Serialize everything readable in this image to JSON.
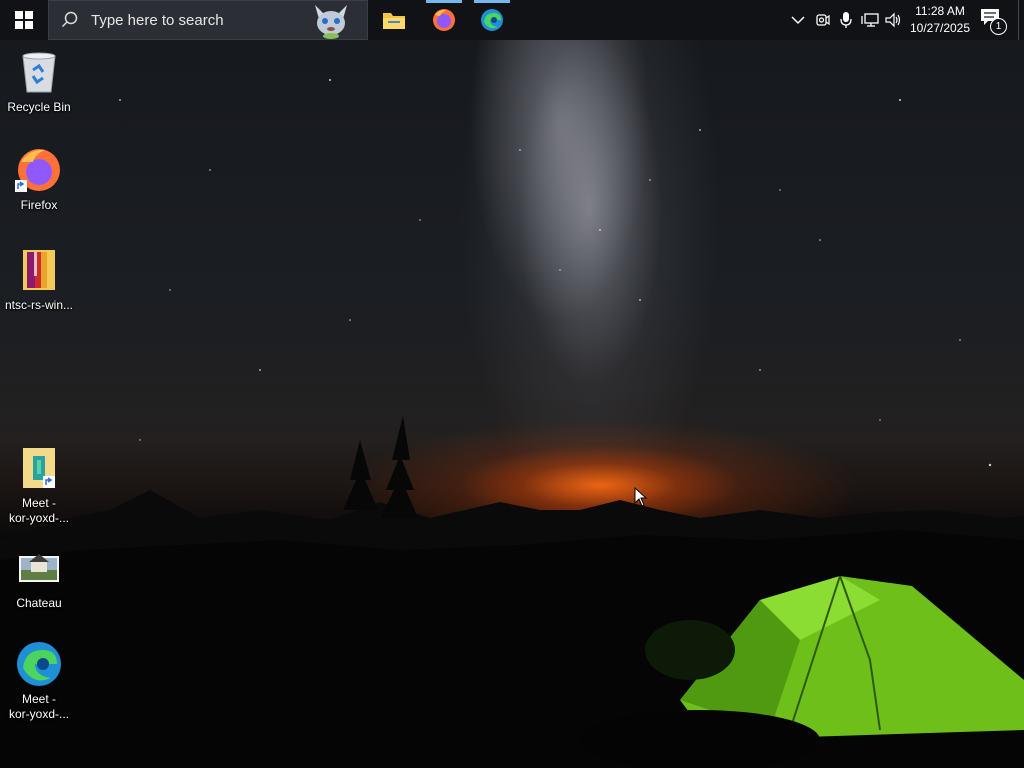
{
  "taskbar": {
    "search_placeholder": "Type here to search",
    "start_icon": "windows-logo-icon",
    "apps": [
      {
        "name": "File Explorer",
        "icon": "folder-icon",
        "running": true
      },
      {
        "name": "Firefox",
        "icon": "firefox-icon",
        "running": true
      },
      {
        "name": "Microsoft Edge",
        "icon": "edge-icon",
        "running": true
      }
    ],
    "tray_icons": [
      "chevron-up-icon",
      "camera-icon",
      "microphone-icon",
      "network-icon",
      "volume-icon"
    ],
    "clock": {
      "time": "11:28 AM",
      "date": "10/27/2025"
    },
    "notification_count": "1",
    "accent_color": "#76b9ed"
  },
  "desktop": {
    "icons": [
      {
        "line1": "Recycle Bin",
        "line2": "",
        "icon": "recycle-bin-icon"
      },
      {
        "line1": "Firefox",
        "line2": "",
        "icon": "firefox-icon"
      },
      {
        "line1": "ntsc-rs-win...",
        "line2": "",
        "icon": "zip-folder-icon"
      },
      {
        "line1": "Meet -",
        "line2": "kor-yoxd-...",
        "icon": "meet-shortcut-icon"
      },
      {
        "line1": "Chateau",
        "line2": "",
        "icon": "image-file-icon"
      },
      {
        "line1": "Meet -",
        "line2": "kor-yoxd-...",
        "icon": "edge-icon"
      }
    ]
  }
}
